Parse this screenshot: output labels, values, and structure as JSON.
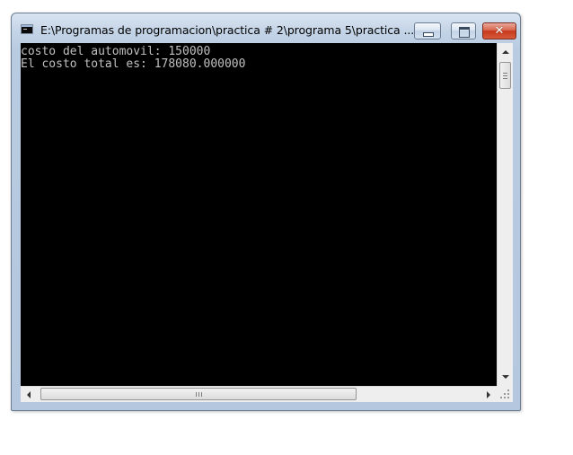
{
  "window": {
    "title": "E:\\Programas de programacion\\practica # 2\\programa 5\\practica ..."
  },
  "controls": {
    "minimize_icon": "minimize-icon",
    "maximize_icon": "maximize-icon",
    "close_icon": "close-icon",
    "close_glyph": "✕"
  },
  "console": {
    "background": "#000000",
    "foreground": "#c0c0c0",
    "lines": [
      "costo del automovil: 150000",
      "El costo total es: 178080.000000"
    ]
  }
}
